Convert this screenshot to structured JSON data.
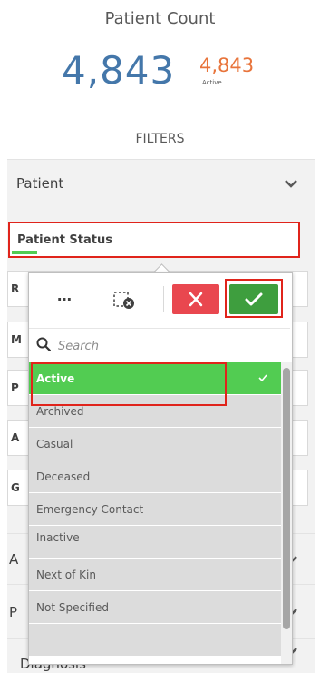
{
  "kpi": {
    "title": "Patient Count",
    "main_value": "4,843",
    "secondary_value": "4,843",
    "secondary_label": "Active"
  },
  "filters": {
    "title": "FILTERS",
    "sections": [
      {
        "label": "Patient"
      },
      {
        "label": "A"
      },
      {
        "label": "P"
      },
      {
        "label": "Diagnosis"
      }
    ],
    "patient_status": {
      "label": "Patient Status"
    },
    "hidden_filter_initials": [
      "R",
      "M",
      "P",
      "A",
      "G"
    ]
  },
  "popup": {
    "more_label": "…",
    "search": {
      "placeholder": "Search"
    },
    "items": [
      {
        "label": "Active",
        "selected": true
      },
      {
        "label": "Archived",
        "selected": false
      },
      {
        "label": "Casual",
        "selected": false
      },
      {
        "label": "Deceased",
        "selected": false
      },
      {
        "label": "Emergency Contact",
        "selected": false
      },
      {
        "label": "Inactive",
        "selected": false
      },
      {
        "label": "Next of Kin",
        "selected": false
      },
      {
        "label": "Not Specified",
        "selected": false
      }
    ]
  },
  "colors": {
    "accent_blue": "#4477aa",
    "accent_orange": "#e8743b",
    "selected_green": "#52cc52",
    "confirm_green": "#3e9e3e",
    "cancel_red": "#e9474f",
    "highlight_red": "#e0241b"
  },
  "icons": {
    "more": "ellipsis-icon",
    "clear": "clear-selection-icon",
    "cancel": "close-icon",
    "confirm": "checkmark-icon",
    "search": "search-icon",
    "chevron": "chevron-down-icon"
  }
}
